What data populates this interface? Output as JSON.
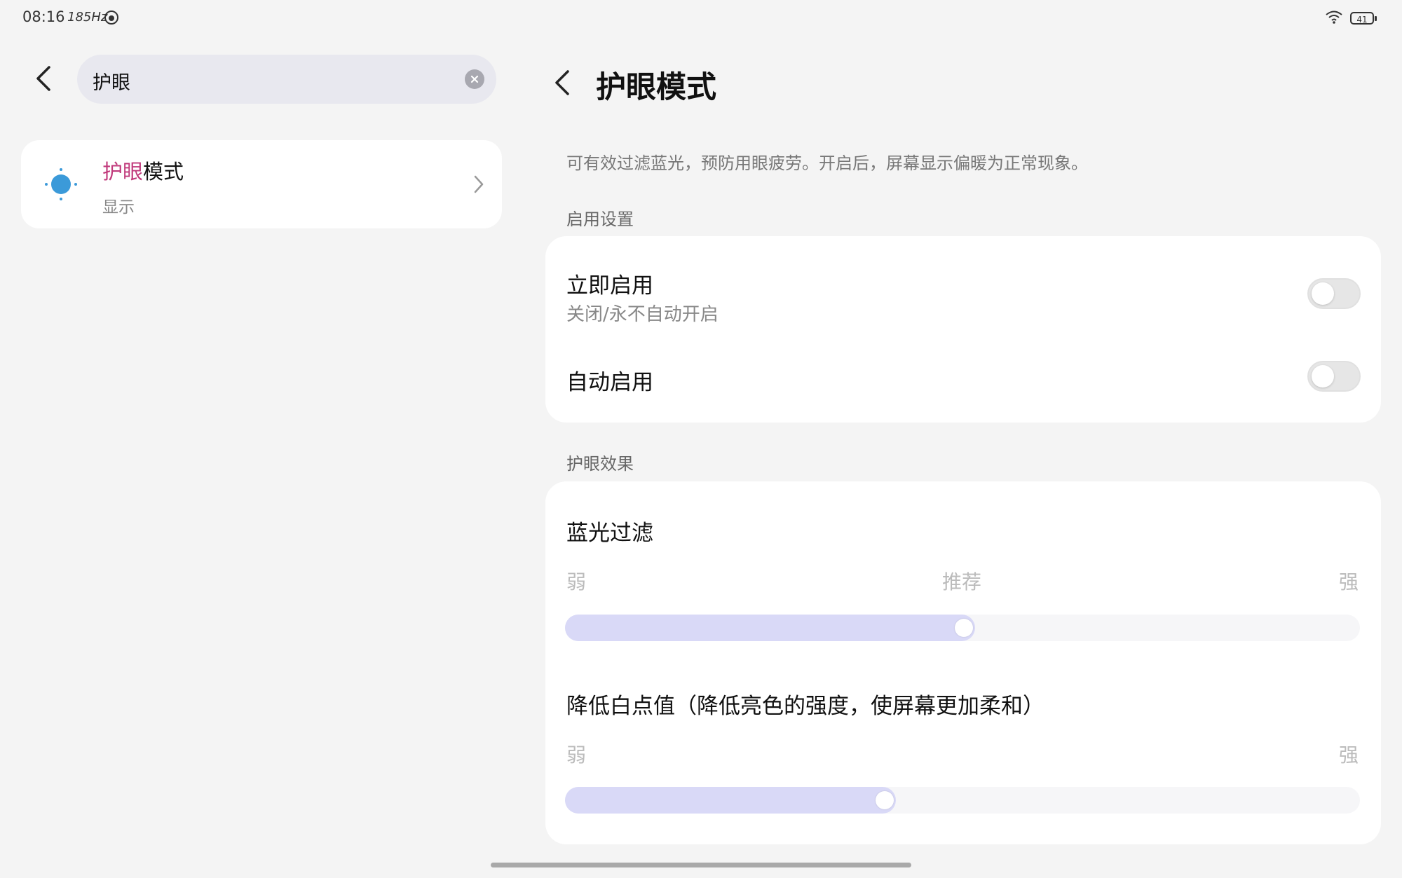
{
  "status_bar": {
    "time": "08:16",
    "refresh_rate": "185Hz",
    "battery": "41"
  },
  "search": {
    "query": "护眼"
  },
  "results": [
    {
      "title_highlight": "护眼",
      "title_rest": "模式",
      "subtitle": "显示",
      "icon": "eye-comfort-sun-icon"
    }
  ],
  "detail": {
    "title": "护眼模式",
    "description": "可有效过滤蓝光，预防用眼疲劳。开启后，屏幕显示偏暖为正常现象。",
    "section_enable": "启用设置",
    "enable_now": {
      "title": "立即启用",
      "subtitle": "关闭/永不自动开启",
      "on": false
    },
    "auto_enable": {
      "title": "自动启用",
      "on": false
    },
    "section_effect": "护眼效果",
    "blue_filter": {
      "title": "蓝光过滤",
      "label_min": "弱",
      "label_mid": "推荐",
      "label_max": "强",
      "level": 0.5
    },
    "white_point": {
      "title": "降低白点值（降低亮色的强度，使屏幕更加柔和）",
      "label_min": "弱",
      "label_max": "强",
      "level": 0.4
    }
  },
  "colors": {
    "accent": "#d9d9f7",
    "highlight": "#c0397b",
    "icon_blue": "#3b9ad9"
  }
}
